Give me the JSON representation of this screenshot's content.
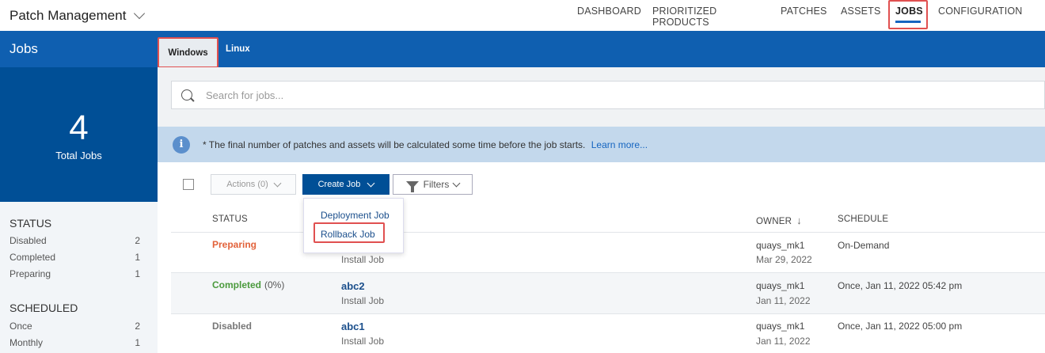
{
  "app": {
    "title": "Patch Management"
  },
  "nav": [
    {
      "label": "DASHBOARD",
      "active": false
    },
    {
      "label": "PRIORITIZED PRODUCTS",
      "active": false
    },
    {
      "label": "PATCHES",
      "active": false
    },
    {
      "label": "ASSETS",
      "active": false
    },
    {
      "label": "JOBS",
      "active": true
    },
    {
      "label": "CONFIGURATION",
      "active": false
    }
  ],
  "sidebar": {
    "title": "Jobs",
    "total": {
      "value": "4",
      "label": "Total Jobs"
    },
    "status": {
      "heading": "STATUS",
      "items": [
        {
          "label": "Disabled",
          "count": "2"
        },
        {
          "label": "Completed",
          "count": "1"
        },
        {
          "label": "Preparing",
          "count": "1"
        }
      ]
    },
    "scheduled": {
      "heading": "SCHEDULED",
      "items": [
        {
          "label": "Once",
          "count": "2"
        },
        {
          "label": "Monthly",
          "count": "1"
        }
      ]
    }
  },
  "tabs": [
    {
      "label": "Windows",
      "active": true
    },
    {
      "label": "Linux",
      "active": false
    }
  ],
  "search": {
    "placeholder": "Search for jobs..."
  },
  "info": {
    "text": "* The final number of patches and assets will be calculated some time before the job starts.",
    "link": "Learn more..."
  },
  "toolbar": {
    "actions_label": "Actions (0)",
    "create_label": "Create Job",
    "filters_label": "Filters"
  },
  "create_menu": {
    "items": [
      "Deployment Job",
      "Rollback Job"
    ]
  },
  "table": {
    "columns": {
      "status": "STATUS",
      "owner": "OWNER",
      "schedule": "SCHEDULE"
    },
    "rows": [
      {
        "status": "Preparing",
        "progress": "",
        "name": "",
        "type": "Install Job",
        "owner": "quays_mk1",
        "owner_date": "Mar 29, 2022",
        "schedule": "On-Demand"
      },
      {
        "status": "Completed",
        "progress": "(0%)",
        "name": "abc2",
        "type": "Install Job",
        "owner": "quays_mk1",
        "owner_date": "Jan 11, 2022",
        "schedule": "Once, Jan 11, 2022 05:42 pm"
      },
      {
        "status": "Disabled",
        "progress": "",
        "name": "abc1",
        "type": "Install Job",
        "owner": "quays_mk1",
        "owner_date": "Jan 11, 2022",
        "schedule": "Once, Jan 11, 2022 05:00 pm"
      }
    ]
  },
  "colors": {
    "primary": "#0f5fb0",
    "dark_primary": "#004f96",
    "highlight": "#e05050",
    "preparing": "#e2623a",
    "completed": "#4b9a3d"
  }
}
